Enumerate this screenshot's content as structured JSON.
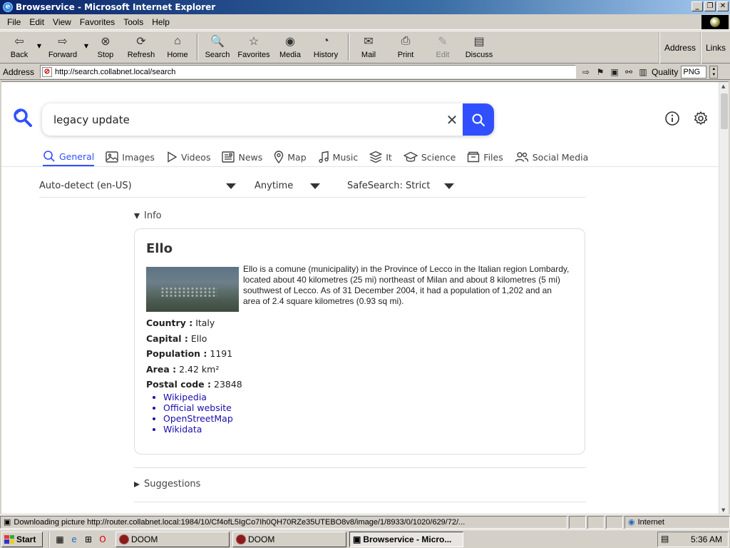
{
  "window": {
    "title": "Browservice - Microsoft Internet Explorer",
    "buttons": [
      "_",
      "❐",
      "✕"
    ]
  },
  "menu": [
    "File",
    "Edit",
    "View",
    "Favorites",
    "Tools",
    "Help"
  ],
  "toolbar": {
    "back": "Back",
    "forward": "Forward",
    "stop": "Stop",
    "refresh": "Refresh",
    "home": "Home",
    "search": "Search",
    "favorites": "Favorites",
    "media": "Media",
    "history": "History",
    "mail": "Mail",
    "print": "Print",
    "edit": "Edit",
    "discuss": "Discuss",
    "address": "Address",
    "links": "Links"
  },
  "addressbar": {
    "label": "Address",
    "url": "http://search.collabnet.local/search",
    "quality_label": "Quality",
    "quality_value": "PNG"
  },
  "page": {
    "query": "legacy update",
    "categories": [
      {
        "label": "General",
        "icon": "search-icon",
        "active": true
      },
      {
        "label": "Images",
        "icon": "image-icon",
        "active": false
      },
      {
        "label": "Videos",
        "icon": "play-icon",
        "active": false
      },
      {
        "label": "News",
        "icon": "news-icon",
        "active": false
      },
      {
        "label": "Map",
        "icon": "map-pin-icon",
        "active": false
      },
      {
        "label": "Music",
        "icon": "music-note-icon",
        "active": false
      },
      {
        "label": "It",
        "icon": "layers-icon",
        "active": false
      },
      {
        "label": "Science",
        "icon": "graduation-cap-icon",
        "active": false
      },
      {
        "label": "Files",
        "icon": "files-icon",
        "active": false
      },
      {
        "label": "Social Media",
        "icon": "people-icon",
        "active": false
      }
    ],
    "filters": {
      "language": "Auto-detect (en-US)",
      "time": "Anytime",
      "safesearch": "SafeSearch: Strict"
    },
    "info_toggle": "Info",
    "infobox": {
      "title": "Ello",
      "description": "Ello is a comune (municipality) in the Province of Lecco in the Italian region Lombardy, located about 40 kilometres (25 mi) northeast of Milan and about 8 kilometres (5 mi) southwest of Lecco. As of 31 December 2004, it had a population of 1,202 and an area of 2.4 square kilometres (0.93 sq mi).",
      "attributes": [
        {
          "label": "Country :",
          "value": "Italy"
        },
        {
          "label": "Capital :",
          "value": "Ello"
        },
        {
          "label": "Population :",
          "value": "1191"
        },
        {
          "label": "Area :",
          "value": "2.42 km²"
        },
        {
          "label": "Postal code :",
          "value": "23848"
        }
      ],
      "links": [
        "Wikipedia",
        "Official website",
        "OpenStreetMap",
        "Wikidata"
      ]
    },
    "suggestions_toggle": "Suggestions"
  },
  "statusbar": {
    "text": "Downloading picture http://router.collabnet.local:1984/10/Cf4ofL5IgCo7Ih0QH70RZe35UTEBO8v8/image/1/8933/0/1020/629/72/...",
    "zone": "Internet"
  },
  "taskbar": {
    "start": "Start",
    "tasks": [
      {
        "label": "DOOM",
        "active": false
      },
      {
        "label": "DOOM",
        "active": false
      },
      {
        "label": "Browservice - Micro...",
        "active": true
      }
    ],
    "clock": "5:36 AM"
  },
  "colors": {
    "accent": "#3050ff",
    "link": "#1a0dab",
    "titlebar": "#0a246a"
  }
}
